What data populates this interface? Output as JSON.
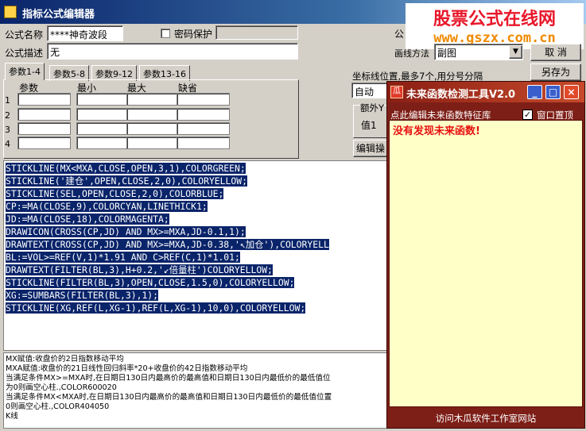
{
  "window": {
    "title": "指标公式编辑器"
  },
  "brand": {
    "line1": "股票公式在线网",
    "line2": "www.gszx.com.cn"
  },
  "form": {
    "name_label": "公式名称",
    "name_value": "****神奇波段",
    "password_label": "密码保护",
    "desc_label": "公式描述",
    "desc_value": "无",
    "right_label_partial": "公",
    "draw_method_label": "画线方法",
    "draw_method_value": "副图",
    "cancel_button": "取  消",
    "save_as_button": "另存为",
    "axis_label": "坐标线位置,最多7个,用分号分隔",
    "axis_select_value": "自动",
    "extra_label": "额外Y",
    "value1_label": "值1",
    "edit_button_partial": "编辑操"
  },
  "tabs": [
    "参数1-4",
    "参数5-8",
    "参数9-12",
    "参数13-16"
  ],
  "param_table": {
    "headers": [
      "参数",
      "最小",
      "最大",
      "缺省"
    ],
    "rows": [
      "1",
      "2",
      "3",
      "4"
    ]
  },
  "code_lines": [
    "STICKLINE(MX<MXA,CLOSE,OPEN,3,1),COLORGREEN;",
    "STICKLINE('建仓',OPEN,CLOSE,2,0),COLORYELLOW;",
    "STICKLINE(SEL,OPEN,CLOSE,2,0),COLORBLUE;",
    "CP:=MA(CLOSE,9),COLORCYAN,LINETHICK1;",
    "JD:=MA(CLOSE,18),COLORMAGENTA;",
    "DRAWICON(CROSS(CP,JD) AND MX>=MXA,JD-0.1,1);",
    "DRAWTEXT(CROSS(CP,JD) AND MX>=MXA,JD-0.38,'↖加仓'),COLORYELL",
    "BL:=VOL>=REF(V,1)*1.91 AND C>REF(C,1)*1.01;",
    "DRAWTEXT(FILTER(BL,3),H+0.2,'↙倍量柱')COLORYELLOW;",
    "STICKLINE(FILTER(BL,3),OPEN,CLOSE,1.5,0),COLORYELLOW;",
    "XG:=SUMBARS(FILTER(BL,3),1);",
    "STICKLINE(XG,REF(L,XG-1),REF(L,XG-1),10,0),COLORYELLOW;"
  ],
  "notes": [
    "MX赋值:收盘价的2日指数移动平均",
    "MXA赋值:收盘价的21日线性回归斜率*20+收盘价的42日指数移动平均",
    " 当满足条件MX>=MXA时,在日期日130日内最高价的最高值和日期日130日内最低价的最低值位",
    "为0则画空心柱.,COLOR600020",
    "当满足条件MX<MXA时,在日期日130日内最高价的最高值和日期日130日内最低价的最低值位置",
    "0则画空心柱.,COLOR404050",
    " K线"
  ],
  "tool": {
    "title": "未来函数检测工具V2.0",
    "icon_text": "瓜",
    "subtitle": "点此编辑未来函数特征库",
    "topmost_label": "窗口置顶",
    "result": "没有发现未来函数!",
    "footer": "访问木瓜软件工作室网站"
  },
  "colors": {
    "code_highlight": "#0a246a",
    "tool_bg": "#7d1f17",
    "tool_body": "#ffffc8",
    "result_text": "#e81010"
  }
}
